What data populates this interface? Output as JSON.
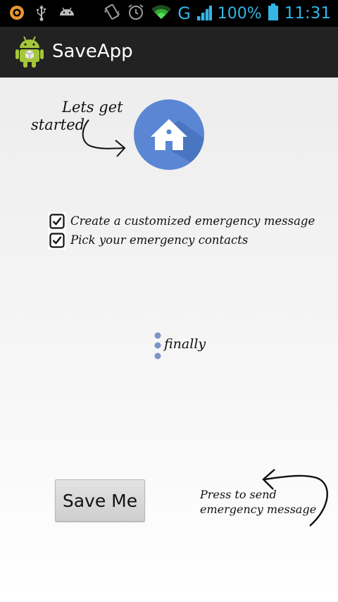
{
  "status_bar": {
    "battery_text": "100%",
    "network_label": "G",
    "time": "11:31",
    "icons": [
      "circle-app-icon",
      "usb-icon",
      "android-debug-icon",
      "vibrate-icon",
      "alarm-icon",
      "wifi-icon",
      "signal-icon",
      "battery-icon"
    ],
    "accent_color": "#33b5e5"
  },
  "action_bar": {
    "title": "SaveApp",
    "icon": "android-robot-icon"
  },
  "content": {
    "intro_line1": "Lets get",
    "intro_line2": "started",
    "home_icon": "home-icon",
    "home_color": "#5a86d4",
    "checklist": [
      {
        "label": "Create a customized emergency message",
        "checked": true
      },
      {
        "label": "Pick your emergency contacts",
        "checked": true
      }
    ],
    "finally_text": "finally",
    "save_button": "Save Me",
    "press_line1": "Press to send",
    "press_line2": "emergency message"
  }
}
